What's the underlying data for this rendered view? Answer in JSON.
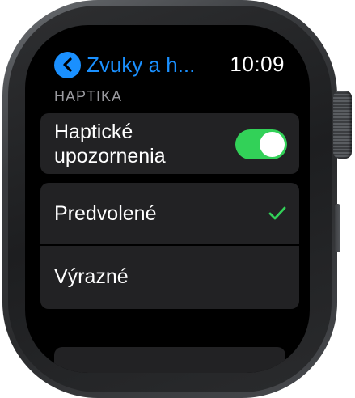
{
  "status_bar": {
    "back_label": "Zvuky a h...",
    "time": "10:09"
  },
  "section": {
    "header": "HAPTIKA"
  },
  "toggle_row": {
    "label": "Haptické upozornenia",
    "on": true
  },
  "options": [
    {
      "label": "Predvolené",
      "selected": true
    },
    {
      "label": "Výrazné",
      "selected": false
    }
  ],
  "colors": {
    "accent": "#1a90ff",
    "toggle_on": "#32d158",
    "cell_bg": "#222224",
    "header_text": "#9a9a9f"
  },
  "icons": {
    "back": "chevron-left-icon",
    "selected": "checkmark-icon"
  }
}
